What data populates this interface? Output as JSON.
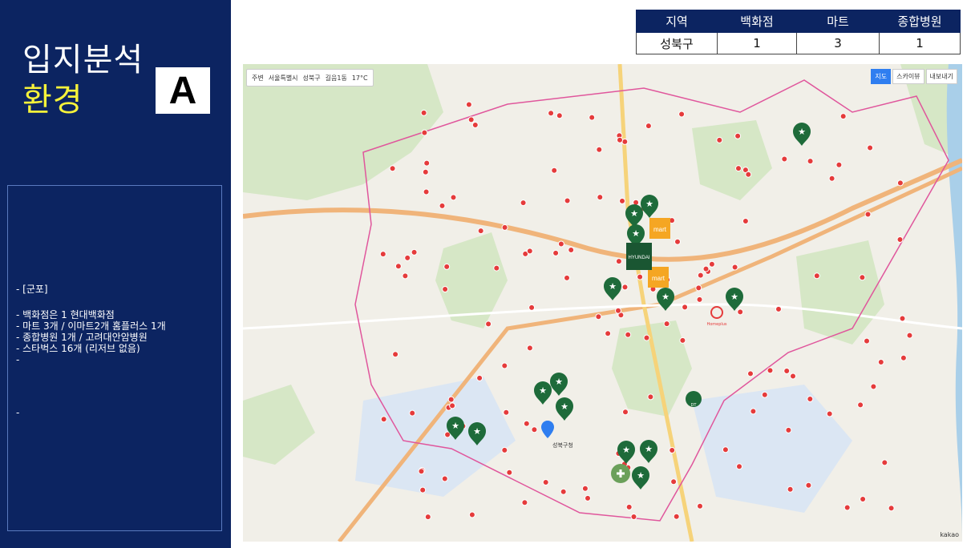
{
  "title": {
    "line1": "입지분석",
    "line2": "환경"
  },
  "badge": "A",
  "notes": [
    "- [군포]",
    "",
    "- 백화점은 1 현대백화점",
    "- 마트 3개 / 이마트2개 홈플러스 1개",
    "- 종합병원 1개 / 고려대안암병원",
    "- 스타벅스 16개 (리저브 없음)",
    "-"
  ],
  "note_extra": "-",
  "stats_table": {
    "headers": [
      "지역",
      "백화점",
      "마트",
      "종합병원"
    ],
    "row": [
      "성북구",
      "1",
      "3",
      "1"
    ]
  },
  "map": {
    "toolbar": {
      "around": "주변",
      "city": "서울특별시",
      "district": "성북구",
      "dong": "길음1동",
      "weather": "17°C"
    },
    "tools": [
      "지도",
      "스카이뷰",
      "내보내기"
    ],
    "labels": {
      "mart": "mart",
      "dept_store": "HYUNDAI",
      "hospital": "Homeplus",
      "dt": "DT",
      "location": "성북구청"
    },
    "attribution": "kakao",
    "colors": {
      "sidebar": "#0c2461",
      "starbucks": "#1e6b3a",
      "apt": "#e53b3b",
      "mart": "#f5a623"
    }
  }
}
